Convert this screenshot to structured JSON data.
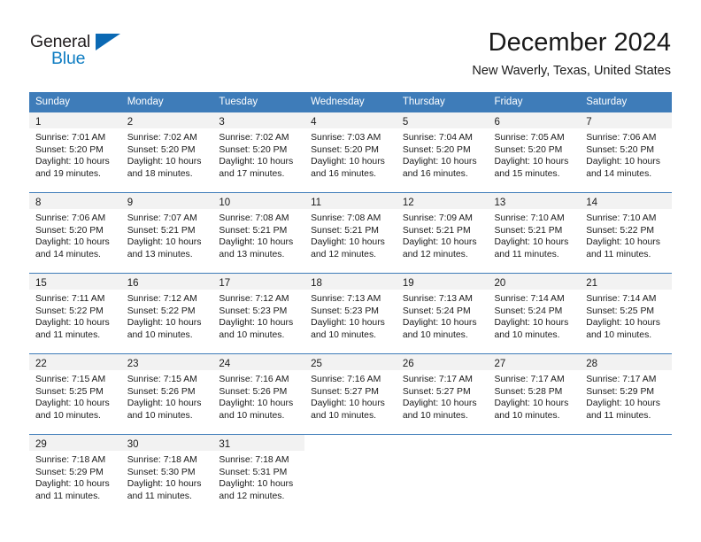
{
  "brand": {
    "name_part1": "General",
    "name_part2": "Blue",
    "triangle_color": "#0b69b4",
    "blue_color": "#0f7dc2"
  },
  "header": {
    "title": "December 2024",
    "subtitle": "New Waverly, Texas, United States",
    "header_bg": "#3e7cb9",
    "daynum_bg": "#f2f2f2"
  },
  "weekdays": [
    "Sunday",
    "Monday",
    "Tuesday",
    "Wednesday",
    "Thursday",
    "Friday",
    "Saturday"
  ],
  "weeks": [
    {
      "days": [
        {
          "day": "1",
          "sunrise": "Sunrise: 7:01 AM",
          "sunset": "Sunset: 5:20 PM",
          "daylight1": "Daylight: 10 hours",
          "daylight2": "and 19 minutes."
        },
        {
          "day": "2",
          "sunrise": "Sunrise: 7:02 AM",
          "sunset": "Sunset: 5:20 PM",
          "daylight1": "Daylight: 10 hours",
          "daylight2": "and 18 minutes."
        },
        {
          "day": "3",
          "sunrise": "Sunrise: 7:02 AM",
          "sunset": "Sunset: 5:20 PM",
          "daylight1": "Daylight: 10 hours",
          "daylight2": "and 17 minutes."
        },
        {
          "day": "4",
          "sunrise": "Sunrise: 7:03 AM",
          "sunset": "Sunset: 5:20 PM",
          "daylight1": "Daylight: 10 hours",
          "daylight2": "and 16 minutes."
        },
        {
          "day": "5",
          "sunrise": "Sunrise: 7:04 AM",
          "sunset": "Sunset: 5:20 PM",
          "daylight1": "Daylight: 10 hours",
          "daylight2": "and 16 minutes."
        },
        {
          "day": "6",
          "sunrise": "Sunrise: 7:05 AM",
          "sunset": "Sunset: 5:20 PM",
          "daylight1": "Daylight: 10 hours",
          "daylight2": "and 15 minutes."
        },
        {
          "day": "7",
          "sunrise": "Sunrise: 7:06 AM",
          "sunset": "Sunset: 5:20 PM",
          "daylight1": "Daylight: 10 hours",
          "daylight2": "and 14 minutes."
        }
      ]
    },
    {
      "days": [
        {
          "day": "8",
          "sunrise": "Sunrise: 7:06 AM",
          "sunset": "Sunset: 5:20 PM",
          "daylight1": "Daylight: 10 hours",
          "daylight2": "and 14 minutes."
        },
        {
          "day": "9",
          "sunrise": "Sunrise: 7:07 AM",
          "sunset": "Sunset: 5:21 PM",
          "daylight1": "Daylight: 10 hours",
          "daylight2": "and 13 minutes."
        },
        {
          "day": "10",
          "sunrise": "Sunrise: 7:08 AM",
          "sunset": "Sunset: 5:21 PM",
          "daylight1": "Daylight: 10 hours",
          "daylight2": "and 13 minutes."
        },
        {
          "day": "11",
          "sunrise": "Sunrise: 7:08 AM",
          "sunset": "Sunset: 5:21 PM",
          "daylight1": "Daylight: 10 hours",
          "daylight2": "and 12 minutes."
        },
        {
          "day": "12",
          "sunrise": "Sunrise: 7:09 AM",
          "sunset": "Sunset: 5:21 PM",
          "daylight1": "Daylight: 10 hours",
          "daylight2": "and 12 minutes."
        },
        {
          "day": "13",
          "sunrise": "Sunrise: 7:10 AM",
          "sunset": "Sunset: 5:21 PM",
          "daylight1": "Daylight: 10 hours",
          "daylight2": "and 11 minutes."
        },
        {
          "day": "14",
          "sunrise": "Sunrise: 7:10 AM",
          "sunset": "Sunset: 5:22 PM",
          "daylight1": "Daylight: 10 hours",
          "daylight2": "and 11 minutes."
        }
      ]
    },
    {
      "days": [
        {
          "day": "15",
          "sunrise": "Sunrise: 7:11 AM",
          "sunset": "Sunset: 5:22 PM",
          "daylight1": "Daylight: 10 hours",
          "daylight2": "and 11 minutes."
        },
        {
          "day": "16",
          "sunrise": "Sunrise: 7:12 AM",
          "sunset": "Sunset: 5:22 PM",
          "daylight1": "Daylight: 10 hours",
          "daylight2": "and 10 minutes."
        },
        {
          "day": "17",
          "sunrise": "Sunrise: 7:12 AM",
          "sunset": "Sunset: 5:23 PM",
          "daylight1": "Daylight: 10 hours",
          "daylight2": "and 10 minutes."
        },
        {
          "day": "18",
          "sunrise": "Sunrise: 7:13 AM",
          "sunset": "Sunset: 5:23 PM",
          "daylight1": "Daylight: 10 hours",
          "daylight2": "and 10 minutes."
        },
        {
          "day": "19",
          "sunrise": "Sunrise: 7:13 AM",
          "sunset": "Sunset: 5:24 PM",
          "daylight1": "Daylight: 10 hours",
          "daylight2": "and 10 minutes."
        },
        {
          "day": "20",
          "sunrise": "Sunrise: 7:14 AM",
          "sunset": "Sunset: 5:24 PM",
          "daylight1": "Daylight: 10 hours",
          "daylight2": "and 10 minutes."
        },
        {
          "day": "21",
          "sunrise": "Sunrise: 7:14 AM",
          "sunset": "Sunset: 5:25 PM",
          "daylight1": "Daylight: 10 hours",
          "daylight2": "and 10 minutes."
        }
      ]
    },
    {
      "days": [
        {
          "day": "22",
          "sunrise": "Sunrise: 7:15 AM",
          "sunset": "Sunset: 5:25 PM",
          "daylight1": "Daylight: 10 hours",
          "daylight2": "and 10 minutes."
        },
        {
          "day": "23",
          "sunrise": "Sunrise: 7:15 AM",
          "sunset": "Sunset: 5:26 PM",
          "daylight1": "Daylight: 10 hours",
          "daylight2": "and 10 minutes."
        },
        {
          "day": "24",
          "sunrise": "Sunrise: 7:16 AM",
          "sunset": "Sunset: 5:26 PM",
          "daylight1": "Daylight: 10 hours",
          "daylight2": "and 10 minutes."
        },
        {
          "day": "25",
          "sunrise": "Sunrise: 7:16 AM",
          "sunset": "Sunset: 5:27 PM",
          "daylight1": "Daylight: 10 hours",
          "daylight2": "and 10 minutes."
        },
        {
          "day": "26",
          "sunrise": "Sunrise: 7:17 AM",
          "sunset": "Sunset: 5:27 PM",
          "daylight1": "Daylight: 10 hours",
          "daylight2": "and 10 minutes."
        },
        {
          "day": "27",
          "sunrise": "Sunrise: 7:17 AM",
          "sunset": "Sunset: 5:28 PM",
          "daylight1": "Daylight: 10 hours",
          "daylight2": "and 10 minutes."
        },
        {
          "day": "28",
          "sunrise": "Sunrise: 7:17 AM",
          "sunset": "Sunset: 5:29 PM",
          "daylight1": "Daylight: 10 hours",
          "daylight2": "and 11 minutes."
        }
      ]
    },
    {
      "days": [
        {
          "day": "29",
          "sunrise": "Sunrise: 7:18 AM",
          "sunset": "Sunset: 5:29 PM",
          "daylight1": "Daylight: 10 hours",
          "daylight2": "and 11 minutes."
        },
        {
          "day": "30",
          "sunrise": "Sunrise: 7:18 AM",
          "sunset": "Sunset: 5:30 PM",
          "daylight1": "Daylight: 10 hours",
          "daylight2": "and 11 minutes."
        },
        {
          "day": "31",
          "sunrise": "Sunrise: 7:18 AM",
          "sunset": "Sunset: 5:31 PM",
          "daylight1": "Daylight: 10 hours",
          "daylight2": "and 12 minutes."
        },
        {
          "day": "",
          "sunrise": "",
          "sunset": "",
          "daylight1": "",
          "daylight2": ""
        },
        {
          "day": "",
          "sunrise": "",
          "sunset": "",
          "daylight1": "",
          "daylight2": ""
        },
        {
          "day": "",
          "sunrise": "",
          "sunset": "",
          "daylight1": "",
          "daylight2": ""
        },
        {
          "day": "",
          "sunrise": "",
          "sunset": "",
          "daylight1": "",
          "daylight2": ""
        }
      ]
    }
  ]
}
